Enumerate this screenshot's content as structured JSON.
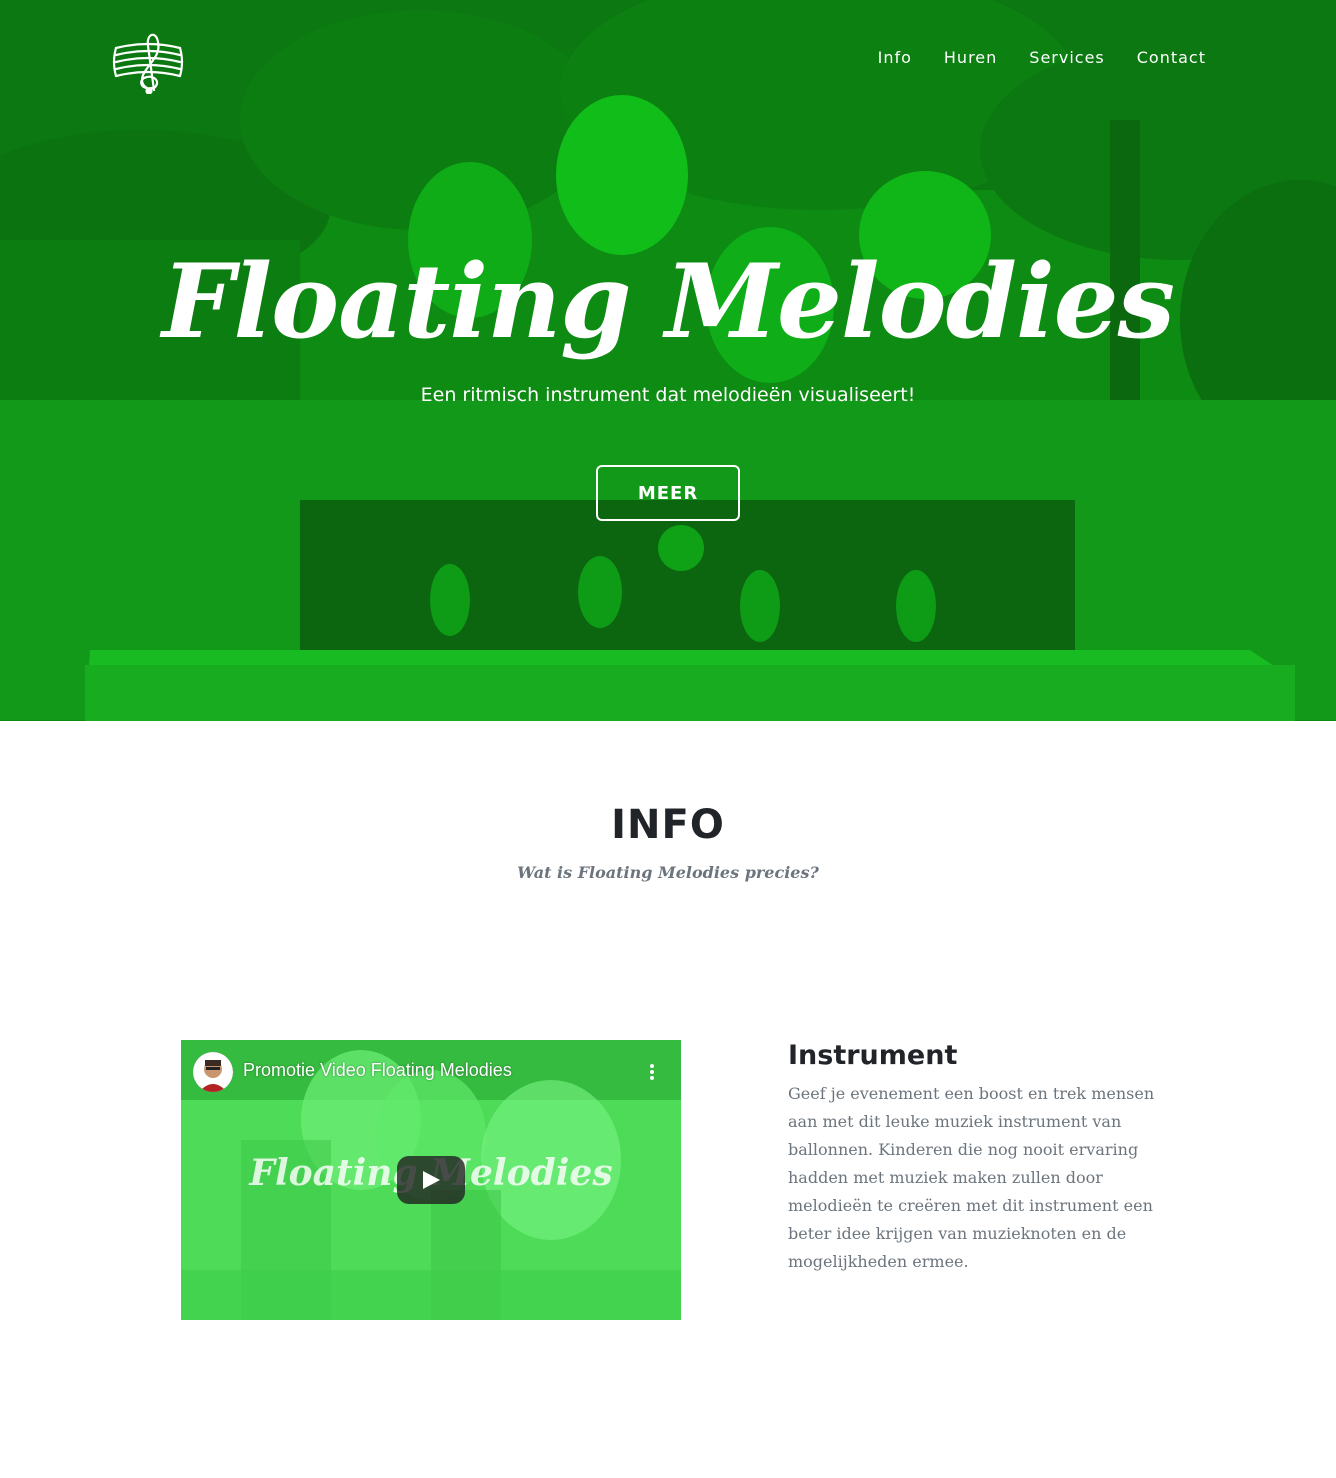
{
  "nav": {
    "logo_icon": "treble-clef-icon",
    "links": [
      "Info",
      "Huren",
      "Services",
      "Contact"
    ]
  },
  "hero": {
    "title": "Floating Melodies",
    "subtitle": "Een ritmisch instrument dat melodieën visualiseert!",
    "button_label": "MEER",
    "overlay_color": "#0e8a14"
  },
  "info": {
    "heading": "INFO",
    "subheading": "Wat is Floating Melodies precies?",
    "video": {
      "title": "Promotie Video Floating Melodies",
      "overlay_text": "Floating Melodies",
      "play_icon": "play-icon",
      "menu_icon": "more-vertical-icon"
    },
    "instrument": {
      "title": "Instrument",
      "text": "Geef je evenement een boost en trek mensen aan met dit leuke muziek instrument van ballonnen. Kinderen die nog nooit ervaring hadden met muziek maken zullen door melodieën te creëren met dit instrument een beter idee krijgen van muzieknoten en de mogelijkheden ermee."
    }
  },
  "colors": {
    "accent_green": "#0e8a14",
    "heading": "#212529",
    "muted": "#6c757d"
  }
}
